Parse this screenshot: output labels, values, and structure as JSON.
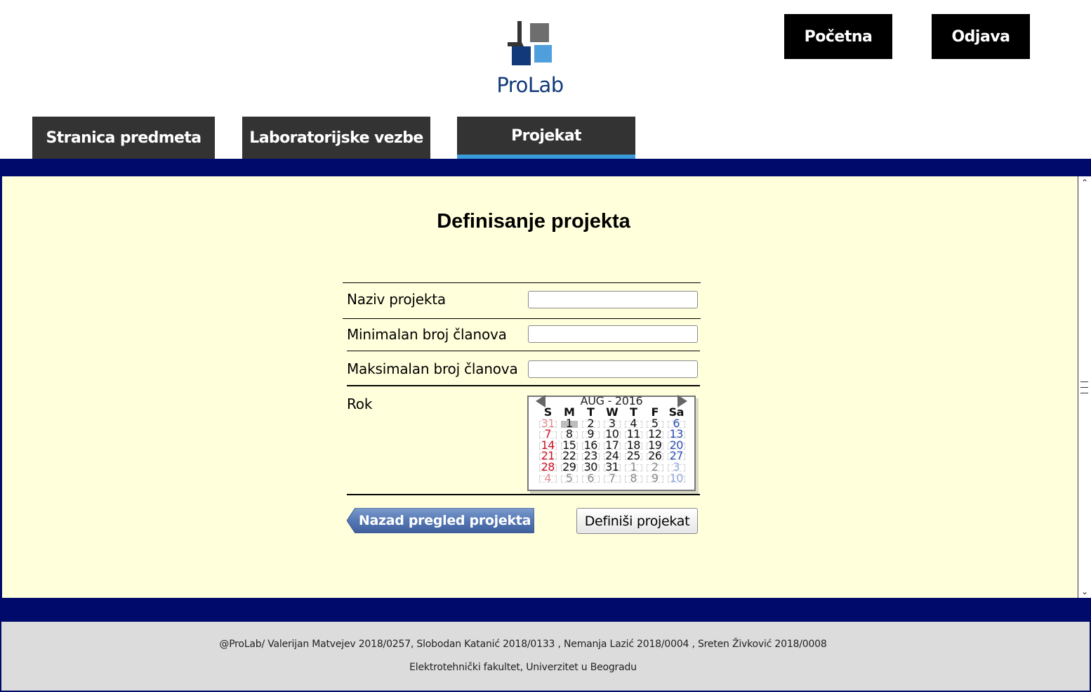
{
  "header": {
    "logo_text": "ProLab",
    "home_label": "Početna",
    "logout_label": "Odjava"
  },
  "tabs": [
    {
      "label": "Stranica predmeta",
      "active": false
    },
    {
      "label": "Laboratorijske vezbe",
      "active": false
    },
    {
      "label": "Projekat",
      "active": true
    }
  ],
  "colors": {
    "navy": "#000a6b",
    "content_bg": "#ffffdc",
    "tab_bg": "#333333",
    "tab_active_underline": "#3a9bd9",
    "back_button": "#4f6fa8",
    "logo_blue": "#123a7a"
  },
  "main": {
    "title": "Definisanje projekta",
    "fields": [
      {
        "label": "Naziv projekta",
        "value": ""
      },
      {
        "label": "Minimalan broj članova",
        "value": ""
      },
      {
        "label": "Maksimalan broj članova",
        "value": ""
      }
    ],
    "deadline_label": "Rok",
    "back_button": "Nazad pregled projekta",
    "submit_button": "Definiši projekat"
  },
  "calendar": {
    "month_label": "AUG - 2016",
    "weekdays": [
      "S",
      "M",
      "T",
      "W",
      "T",
      "F",
      "Sa"
    ],
    "weeks": [
      [
        "31",
        "1",
        "2",
        "3",
        "4",
        "5",
        "6"
      ],
      [
        "7",
        "8",
        "9",
        "10",
        "11",
        "12",
        "13"
      ],
      [
        "14",
        "15",
        "16",
        "17",
        "18",
        "19",
        "20"
      ],
      [
        "21",
        "22",
        "23",
        "24",
        "25",
        "26",
        "27"
      ],
      [
        "28",
        "29",
        "30",
        "31",
        "1",
        "2",
        "3"
      ],
      [
        "4",
        "5",
        "6",
        "7",
        "8",
        "9",
        "10"
      ]
    ],
    "selected_day": "1",
    "prev_icon": "triangle-left-icon",
    "next_icon": "triangle-right-icon"
  },
  "footer": {
    "line1": "@ProLab/ Valerijan Matvejev 2018/0257, Slobodan Katanić 2018/0133 , Nemanja Lazić 2018/0004 , Sreten Živković 2018/0008",
    "line2": "Elektrotehnički fakultet, Univerzitet u Beogradu"
  }
}
